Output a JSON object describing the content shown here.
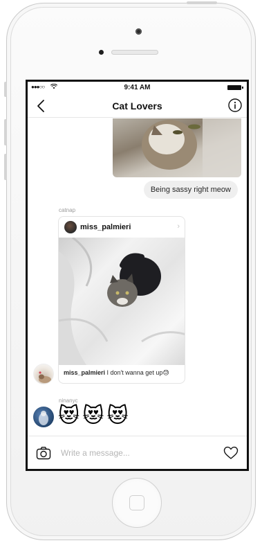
{
  "status_bar": {
    "signal": "●●●○○",
    "time": "9:41 AM"
  },
  "nav": {
    "title": "Cat Lovers"
  },
  "messages": {
    "outgoing_text": "Being sassy right meow",
    "shared_post": {
      "sender": "catnap",
      "username": "miss_palmieri",
      "caption_user": "miss_palmieri",
      "caption_text": " I don't wanna get up😓"
    },
    "reaction": {
      "sender": "ninanyc",
      "emojis": "😻😻😻"
    }
  },
  "composer": {
    "placeholder": "Write a message..."
  },
  "colors": {
    "text": "#262626",
    "bubble": "#efefef",
    "border": "#e6e6e6"
  }
}
